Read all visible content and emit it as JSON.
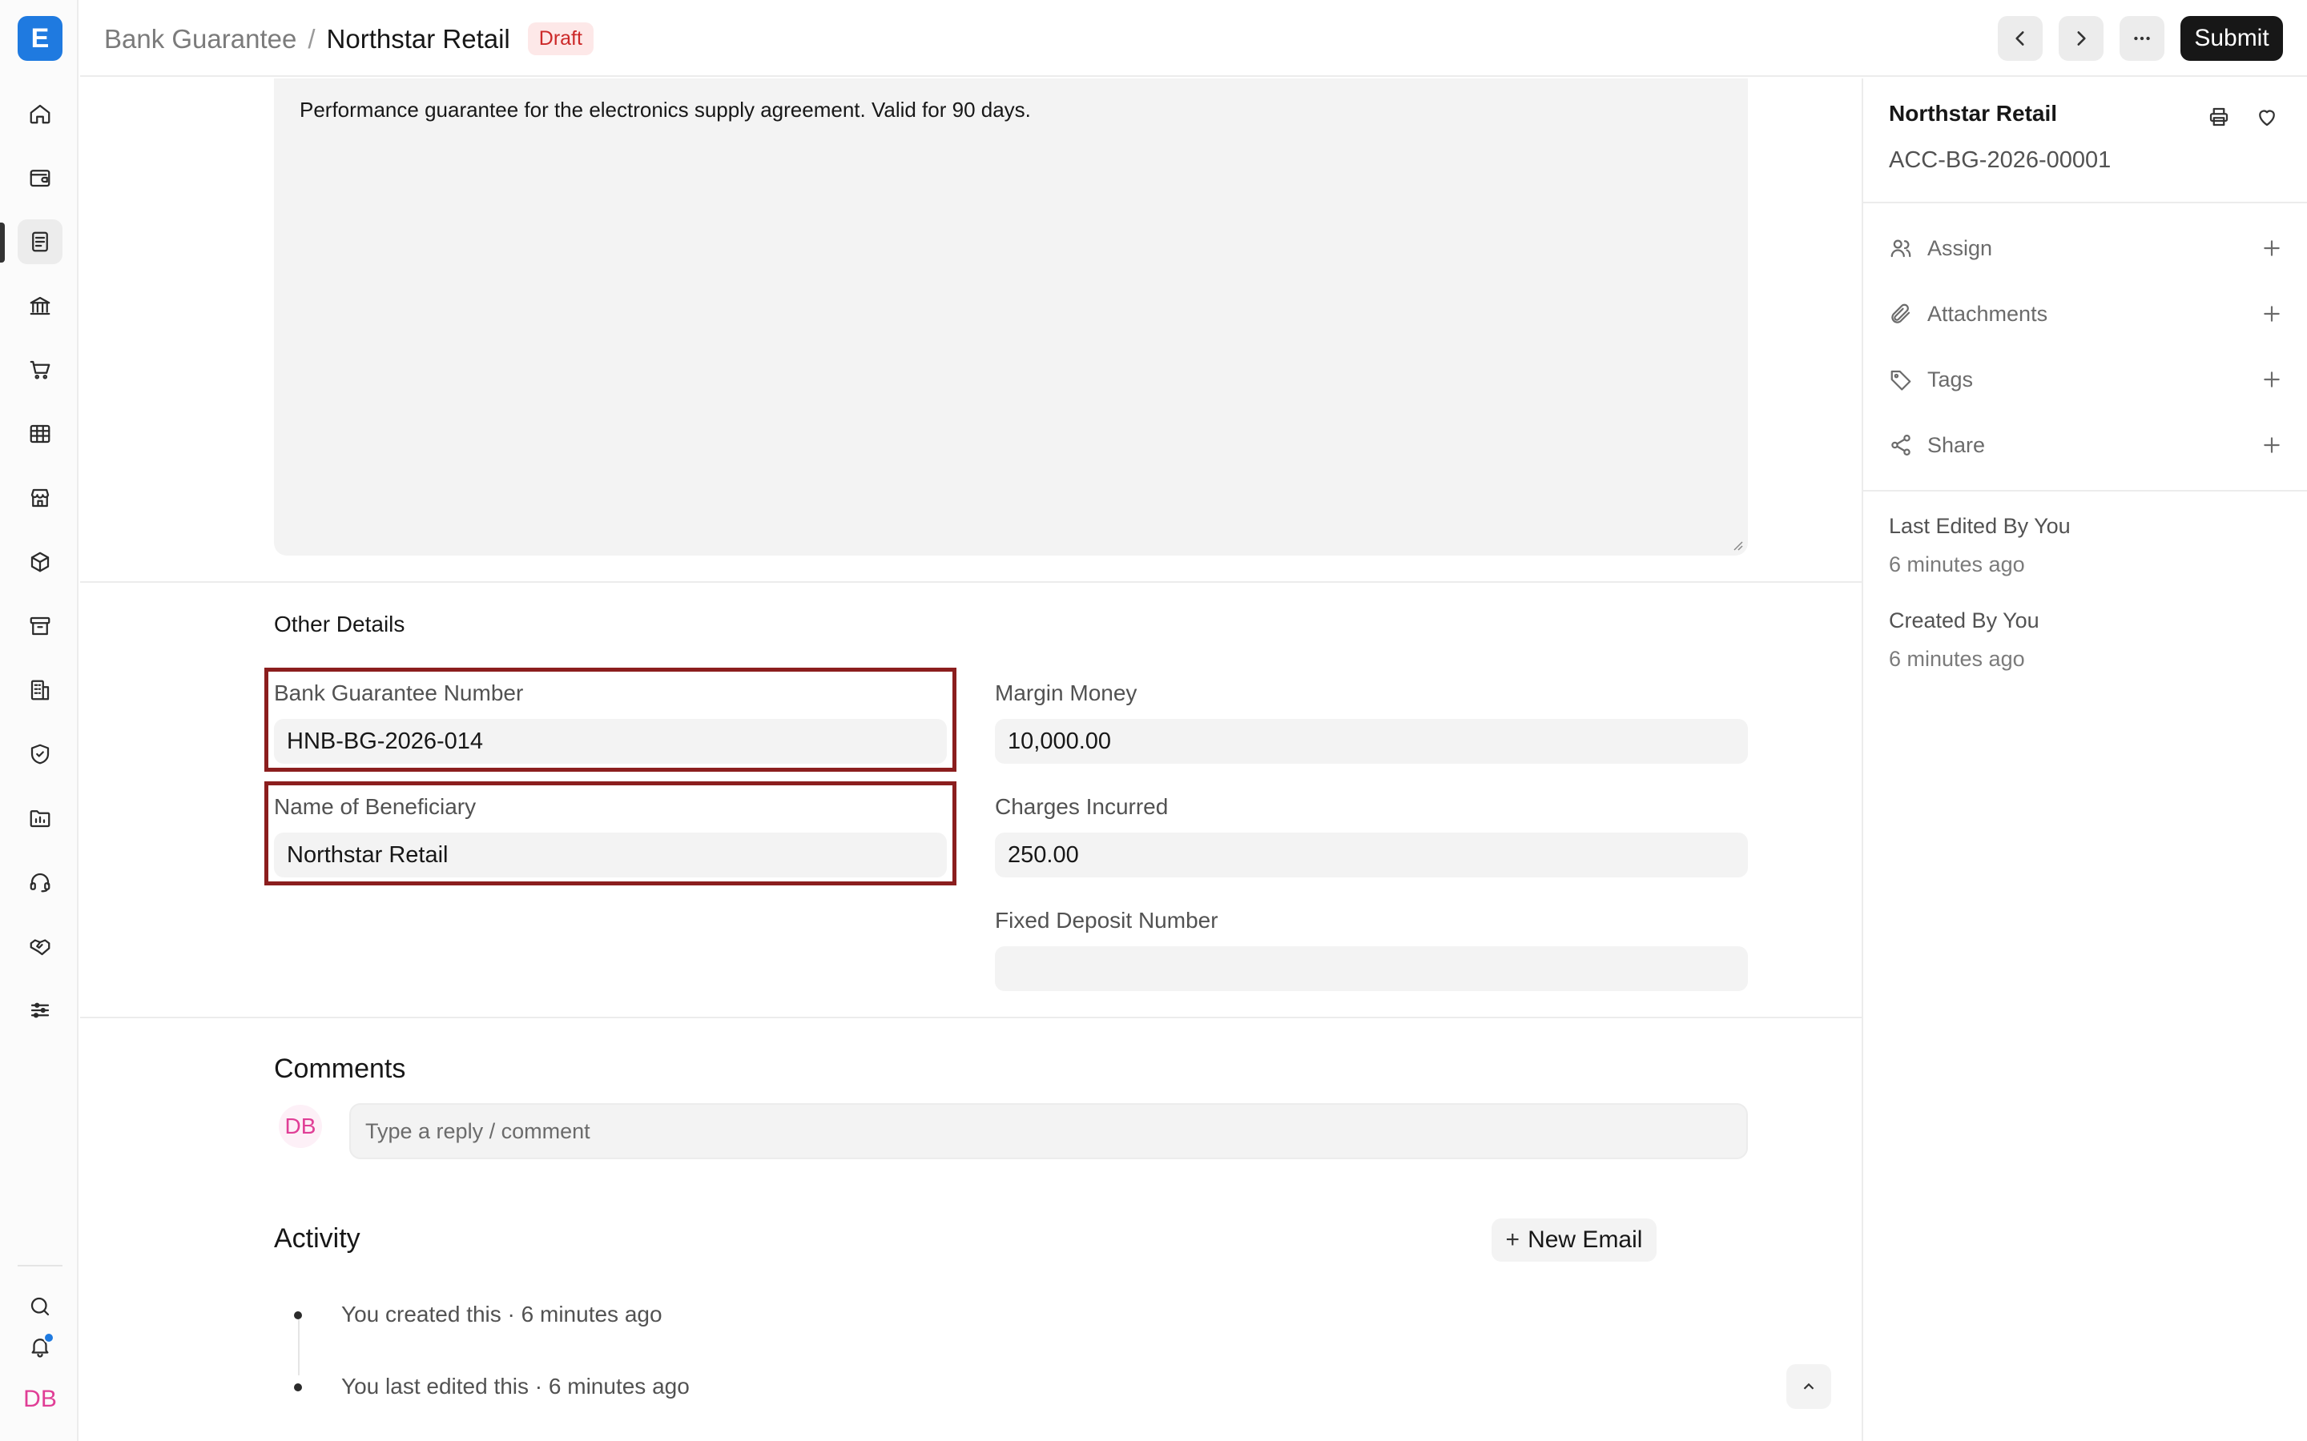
{
  "app": {
    "logo_letter": "E"
  },
  "sidebar": {
    "items": [
      {
        "name": "home-icon"
      },
      {
        "name": "wallet-icon"
      },
      {
        "name": "document-icon",
        "active": true
      },
      {
        "name": "bank-icon"
      },
      {
        "name": "cart-icon"
      },
      {
        "name": "table-icon"
      },
      {
        "name": "store-icon"
      },
      {
        "name": "package-icon"
      },
      {
        "name": "archive-icon"
      },
      {
        "name": "building-icon"
      },
      {
        "name": "shield-icon"
      },
      {
        "name": "folder-chart-icon"
      },
      {
        "name": "headset-icon"
      },
      {
        "name": "handshake-icon"
      },
      {
        "name": "sliders-icon"
      }
    ],
    "user_initials": "DB"
  },
  "header": {
    "breadcrumb_parent": "Bank Guarantee",
    "breadcrumb_separator": "/",
    "breadcrumb_current": "Northstar Retail",
    "status": "Draft",
    "submit_label": "Submit"
  },
  "form": {
    "remarks": "Performance guarantee for the electronics supply agreement. Valid for 90 days.",
    "other_details_title": "Other Details",
    "fields": {
      "bank_guarantee_number": {
        "label": "Bank Guarantee Number",
        "value": "HNB-BG-2026-014"
      },
      "name_of_beneficiary": {
        "label": "Name of Beneficiary",
        "value": "Northstar Retail"
      },
      "margin_money": {
        "label": "Margin Money",
        "value": "10,000.00"
      },
      "charges_incurred": {
        "label": "Charges Incurred",
        "value": "250.00"
      },
      "fixed_deposit_number": {
        "label": "Fixed Deposit Number",
        "value": ""
      }
    }
  },
  "comments": {
    "title": "Comments",
    "avatar_initials": "DB",
    "placeholder": "Type a reply / comment"
  },
  "activity": {
    "title": "Activity",
    "new_email_label": "New Email",
    "items": [
      "You created this · 6 minutes ago",
      "You last edited this · 6 minutes ago"
    ]
  },
  "right_panel": {
    "title": "Northstar Retail",
    "doc_id": "ACC-BG-2026-00001",
    "actions": [
      "Assign",
      "Attachments",
      "Tags",
      "Share"
    ],
    "last_edited_label": "Last Edited By You",
    "last_edited_time": "6 minutes ago",
    "created_label": "Created By You",
    "created_time": "6 minutes ago"
  },
  "colors": {
    "accent": "#1f7ae0",
    "highlight_border": "#8b1e1e",
    "draft_badge_bg": "#fde8e8",
    "draft_badge_text": "#cc2929",
    "avatar_pink": "#e03e96"
  }
}
